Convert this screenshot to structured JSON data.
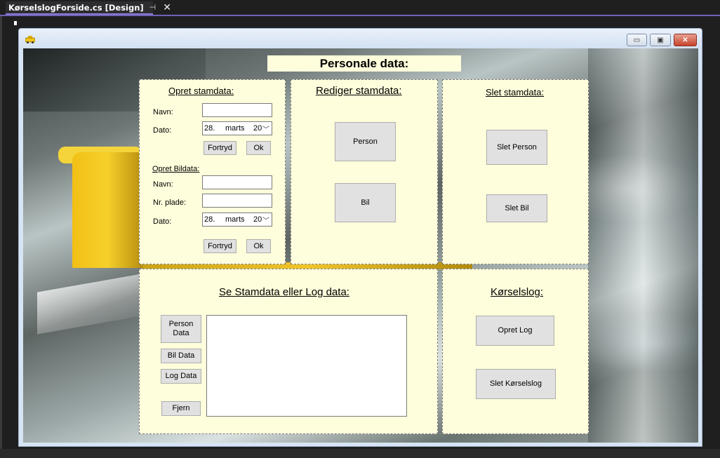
{
  "ide": {
    "document_tab": "KørselslogForside.cs [Design]",
    "pin_icon": "pin-icon",
    "close_icon": "close-icon"
  },
  "form": {
    "title": "",
    "controls": {
      "minimize": "▭",
      "maximize": "▣",
      "close": "✕"
    },
    "header_label": "Personale data:",
    "colors": {
      "panel_bg": "#fffedc",
      "button_bg": "#e1e1e1",
      "accent_tab": "#6e63b8"
    }
  },
  "opret_panel": {
    "heading": "Opret stamdata:",
    "navn_label": "Navn:",
    "navn_value": "",
    "dato_label": "Dato:",
    "dato_day": "28.",
    "dato_month": "marts",
    "dato_year": "20",
    "fortryd_label": "Fortryd",
    "ok_label": "Ok",
    "bil_heading": "Opret Bildata:",
    "bil_navn_label": "Navn:",
    "bil_navn_value": "",
    "plade_label": "Nr. plade:",
    "plade_value": "",
    "bil_dato_label": "Dato:",
    "bil_dato_day": "28.",
    "bil_dato_month": "marts",
    "bil_dato_year": "20",
    "bil_fortryd_label": "Fortryd",
    "bil_ok_label": "Ok"
  },
  "rediger_panel": {
    "heading": "Rediger stamdata:",
    "person_button": "Person",
    "bil_button": "Bil"
  },
  "slet_panel": {
    "heading": "Slet stamdata:",
    "slet_person_button": "Slet Person",
    "slet_bil_button": "Slet Bil"
  },
  "se_panel": {
    "heading": "Se Stamdata eller Log data:",
    "person_data_button": "Person Data",
    "bil_data_button": "Bil Data",
    "log_data_button": "Log Data",
    "fjern_button": "Fjern"
  },
  "korselslog_panel": {
    "heading": "Kørselslog:",
    "opret_log_button": "Opret Log",
    "slet_korselslog_button": "Slet Kørselslog"
  }
}
